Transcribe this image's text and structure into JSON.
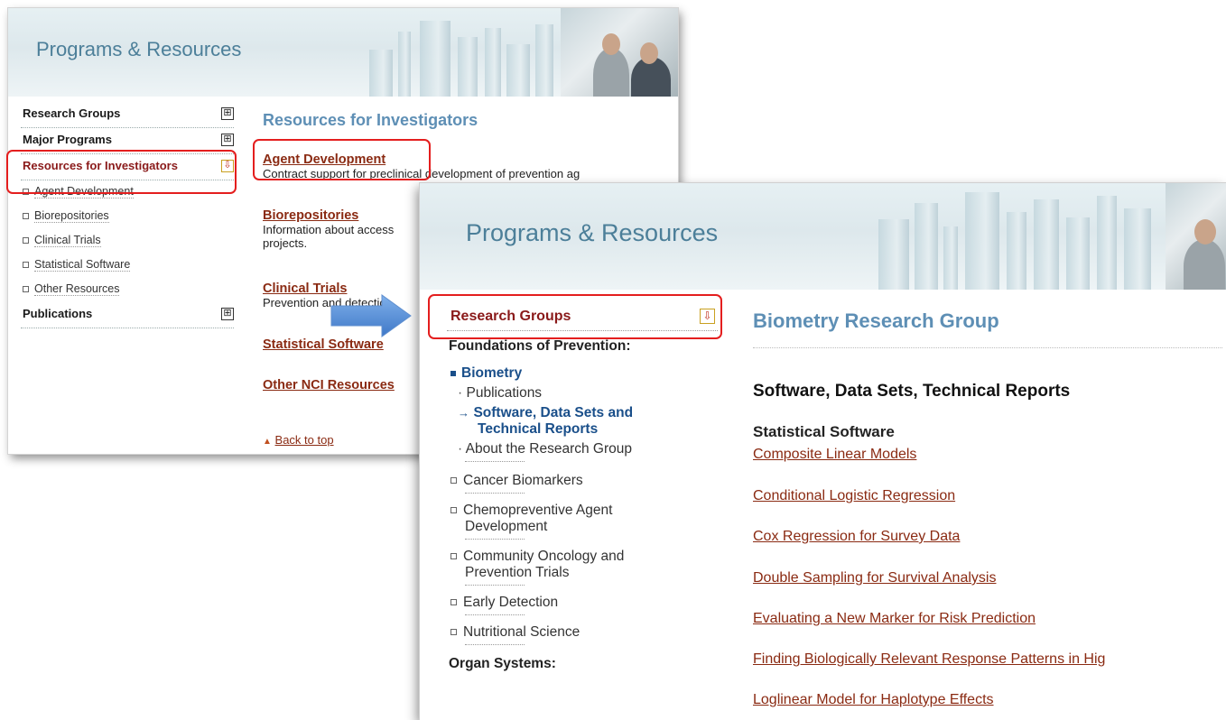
{
  "card1": {
    "banner_title": "Programs & Resources",
    "nav": [
      {
        "label": "Research Groups",
        "icon": "⊞"
      },
      {
        "label": "Major Programs",
        "icon": "⊞"
      },
      {
        "label": "Resources for Investigators",
        "icon": "⇩"
      }
    ],
    "subitems": [
      "Agent Development",
      "Biorepositories",
      "Clinical Trials",
      "Statistical Software",
      "Other Resources"
    ],
    "publications": {
      "label": "Publications",
      "icon": "⊞"
    },
    "heading": "Resources for Investigators",
    "items": [
      {
        "title": "Agent Development",
        "desc": "Contract support for preclinical development of prevention ag"
      },
      {
        "title": "Biorepositories",
        "desc": "Information about access",
        "desc2": "projects."
      },
      {
        "title": "Clinical Trials",
        "desc": "Prevention and detectio"
      },
      {
        "title": "Statistical Software"
      },
      {
        "title": "Other NCI Resources"
      }
    ],
    "back_to_top": "Back to top"
  },
  "card2": {
    "banner_title": "Programs & Resources",
    "research_groups": {
      "label": "Research Groups",
      "icon": "⇩"
    },
    "foundations": "Foundations of Prevention:",
    "biometry": "Biometry",
    "publications": "Publications",
    "software_line1": "Software, Data Sets and",
    "software_line2": "Technical Reports",
    "about": "About the Research Group",
    "groups": [
      {
        "line1": "Cancer Biomarkers"
      },
      {
        "line1": "Chemopreventive Agent",
        "line2": "Development"
      },
      {
        "line1": "Community Oncology and",
        "line2": "Prevention Trials"
      },
      {
        "line1": "Early Detection"
      },
      {
        "line1": "Nutritional Science"
      }
    ],
    "organ_systems": "Organ Systems:",
    "heading": "Biometry Research Group",
    "subheading": "Software, Data Sets, Technical Reports",
    "stat_software": "Statistical Software",
    "links": [
      "Composite Linear Models",
      "Conditional Logistic Regression",
      "Cox Regression for Survey Data",
      "Double Sampling for Survival Analysis",
      "Evaluating a New Marker for Risk Prediction",
      "Finding Biologically Relevant Response Patterns in Hig",
      "Loglinear Model for Haplotype Effects"
    ]
  },
  "colors": {
    "highlight": "#e41e1e",
    "link": "#8a2a12",
    "heading_blue": "#5e8fb5",
    "banner_text": "#4c7f99",
    "arrow": "#5b8fd6"
  }
}
